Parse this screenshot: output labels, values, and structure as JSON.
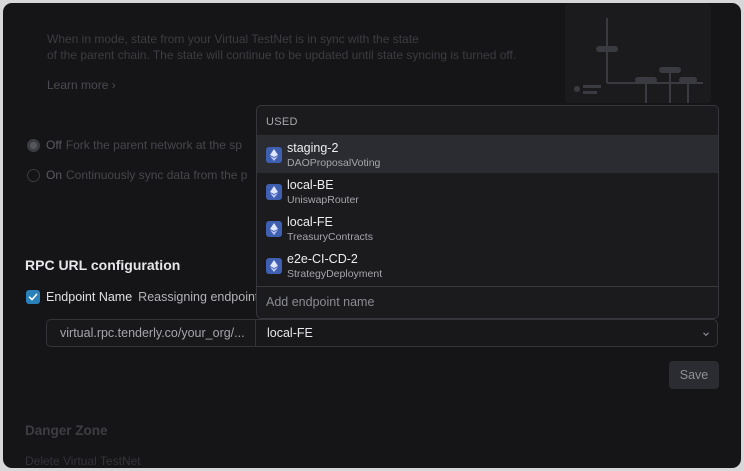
{
  "background": {
    "paragraph_line1": "When in  mode, state  from your Virtual TestNet is  in sync with the  state",
    "paragraph_line2": "of the parent chain. The state will continue to be updated until state syncing is turned off.",
    "learn_more": "Learn more",
    "fork_options": [
      {
        "name": "Off",
        "desc": "Fork the parent network at the sp"
      },
      {
        "name": "On",
        "desc": "Continuously sync data from the p"
      }
    ],
    "danger_zone_title": "Danger Zone",
    "danger_zone_sub": "Delete Virtual TestNet"
  },
  "rpc": {
    "title": "RPC URL configuration",
    "checkbox_label": "Endpoint Name",
    "checkbox_hint": "Reassigning endpoint",
    "checkbox_checked": true,
    "url_prefix": "virtual.rpc.tenderly.co/your_org/...",
    "selected_endpoint": "local-FE",
    "save_label": "Save"
  },
  "dropdown": {
    "header": "USED",
    "items": [
      {
        "name": "staging-2",
        "contract": "DAOProposalVoting",
        "active": true
      },
      {
        "name": "local-BE",
        "contract": "UniswapRouter",
        "active": false
      },
      {
        "name": "local-FE",
        "contract": "TreasuryContracts",
        "active": false
      },
      {
        "name": "e2e-CI-CD-2",
        "contract": "StrategyDeployment",
        "active": false
      }
    ],
    "add_placeholder": "Add endpoint name"
  },
  "colors": {
    "accent_checkbox": "#2a80b9",
    "network_icon": "#3f5fb0"
  },
  "icons": {
    "network": "ethereum-icon",
    "select_chevron": "chevron-down-icon",
    "check": "check-icon"
  }
}
